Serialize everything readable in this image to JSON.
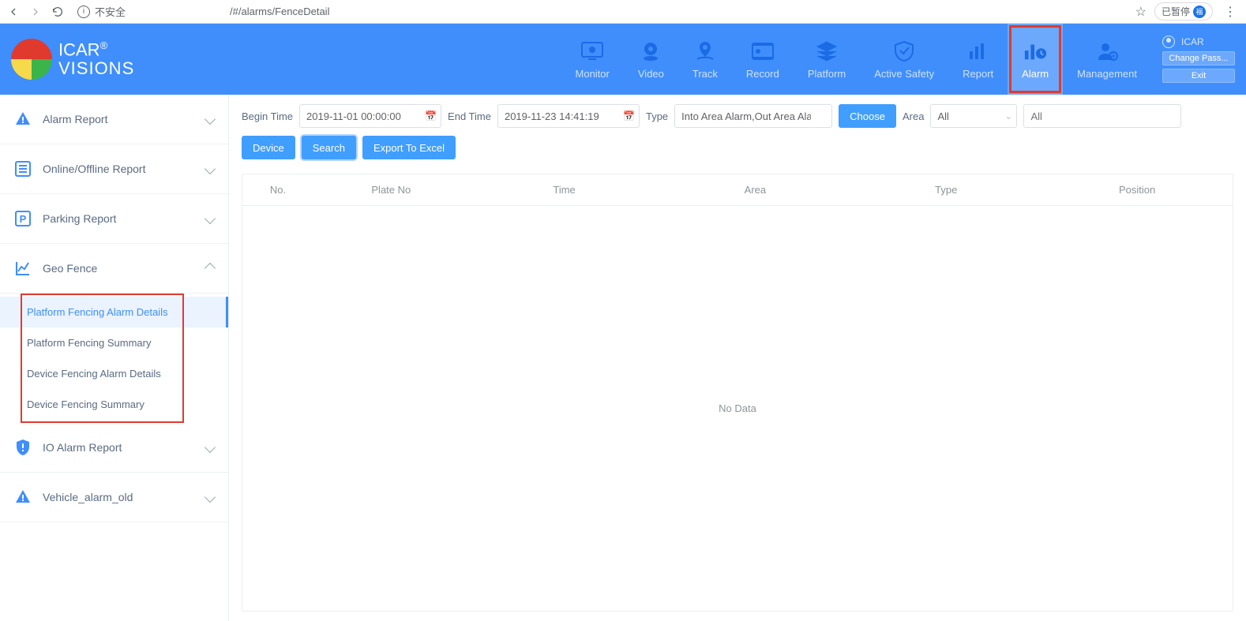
{
  "browser": {
    "insecure_label": "不安全",
    "url_fragment": "/#/alarms/FenceDetail",
    "paused_label": "已暂停",
    "paused_badge": "福"
  },
  "brand": {
    "line1": "ICAR",
    "reg": "®",
    "line2": "VISIONS"
  },
  "topnav": [
    {
      "id": "monitor",
      "label": "Monitor"
    },
    {
      "id": "video",
      "label": "Video"
    },
    {
      "id": "track",
      "label": "Track"
    },
    {
      "id": "record",
      "label": "Record"
    },
    {
      "id": "platform",
      "label": "Platform"
    },
    {
      "id": "active-safety",
      "label": "Active Safety"
    },
    {
      "id": "report",
      "label": "Report"
    },
    {
      "id": "alarm",
      "label": "Alarm",
      "active": true
    },
    {
      "id": "management",
      "label": "Management"
    }
  ],
  "user": {
    "name": "ICAR",
    "change_pass": "Change Pass...",
    "exit": "Exit"
  },
  "sidebar": [
    {
      "id": "alarm-report",
      "label": "Alarm Report",
      "icon": "warning"
    },
    {
      "id": "online-offline",
      "label": "Online/Offline Report",
      "icon": "list"
    },
    {
      "id": "parking",
      "label": "Parking Report",
      "icon": "parking"
    },
    {
      "id": "geo-fence",
      "label": "Geo Fence",
      "icon": "chart",
      "expanded": true,
      "children": [
        {
          "id": "pf-alarm-details",
          "label": "Platform Fencing Alarm Details",
          "active": true
        },
        {
          "id": "pf-summary",
          "label": "Platform Fencing Summary"
        },
        {
          "id": "df-alarm-details",
          "label": "Device Fencing Alarm Details"
        },
        {
          "id": "df-summary",
          "label": "Device Fencing Summary"
        }
      ]
    },
    {
      "id": "io-alarm",
      "label": "IO Alarm Report",
      "icon": "shield"
    },
    {
      "id": "vehicle-alarm-old",
      "label": "Vehicle_alarm_old",
      "icon": "warning"
    }
  ],
  "filters": {
    "begin_label": "Begin Time",
    "begin_value": "2019-11-01 00:00:00",
    "end_label": "End Time",
    "end_value": "2019-11-23 14:41:19",
    "type_label": "Type",
    "type_value": "Into Area Alarm,Out Area Alarm",
    "choose": "Choose",
    "area_label": "Area",
    "area_value": "All",
    "all_placeholder": "All",
    "device_btn": "Device",
    "search_btn": "Search",
    "export_btn": "Export To Excel"
  },
  "table": {
    "cols": {
      "no": "No.",
      "plate": "Plate No",
      "time": "Time",
      "area": "Area",
      "type": "Type",
      "position": "Position"
    },
    "empty": "No Data"
  }
}
